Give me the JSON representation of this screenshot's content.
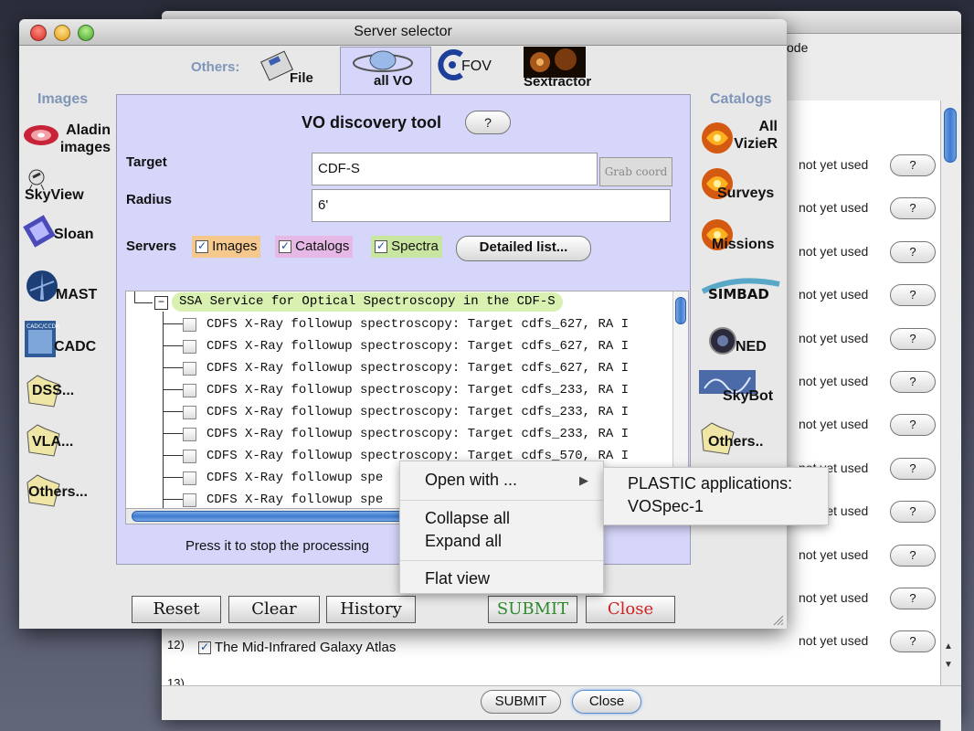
{
  "background_window": {
    "partial_title": "ode",
    "row_status": "not yet used",
    "row_help": "?",
    "rows_count_visible": 12,
    "row12_index": "12)",
    "row12_label": "The Mid-Infrared Galaxy Atlas",
    "row13_index": "13)",
    "submit_label": "SUBMIT",
    "close_label": "Close",
    "scroll_up": "▲",
    "scroll_down": "▼"
  },
  "window": {
    "title": "Server selector"
  },
  "left_sidebar": {
    "header": "Images",
    "items": [
      "Aladin images",
      "SkyView",
      "Sloan",
      "MAST",
      "CADC",
      "DSS...",
      "VLA...",
      "Others..."
    ]
  },
  "right_sidebar": {
    "header": "Catalogs",
    "items": [
      "All VizieR",
      "Surveys",
      "Missions",
      "SIMBAD",
      "NED",
      "SkyBot",
      "Others.."
    ]
  },
  "tabs": {
    "others_label": "Others:",
    "items": [
      "File",
      "all VO",
      "FOV",
      "Sextractor"
    ]
  },
  "panel": {
    "title": "VO discovery tool",
    "help": "?",
    "target_label": "Target",
    "target_value": "CDF-S",
    "grab_label": "Grab coord",
    "radius_label": "Radius",
    "radius_value": "6'",
    "servers_label": "Servers",
    "server_checks": [
      "Images",
      "Catalogs",
      "Spectra"
    ],
    "detailed_label": "Detailed list...",
    "status": "Press it to stop the processing"
  },
  "tree": {
    "collapse_symbol": "−",
    "root": "SSA Service for Optical Spectroscopy in the CDF-S",
    "rows": [
      "CDFS X-Ray followup spectroscopy: Target cdfs_627, RA I",
      "CDFS X-Ray followup spectroscopy: Target cdfs_627, RA I",
      "CDFS X-Ray followup spectroscopy: Target cdfs_627, RA I",
      "CDFS X-Ray followup spectroscopy: Target cdfs_233, RA I",
      "CDFS X-Ray followup spectroscopy: Target cdfs_233, RA I",
      "CDFS X-Ray followup spectroscopy: Target cdfs_233, RA I",
      "CDFS X-Ray followup spectroscopy: Target cdfs_570, RA I",
      "CDFS X-Ray followup spe",
      "CDFS X-Ray followup spe"
    ]
  },
  "buttons": {
    "reset": "Reset",
    "clear": "Clear",
    "history": "History",
    "submit": "SUBMIT",
    "close": "Close"
  },
  "context_menu": {
    "open_with": "Open with ...",
    "collapse_all": "Collapse all",
    "expand_all": "Expand all",
    "flat_view": "Flat view"
  },
  "submenu": {
    "header": "PLASTIC applications:",
    "app": "VOSpec-1"
  },
  "colors": {
    "panel_bg": "#d6d6fa",
    "images_chk": "#f5c98e",
    "catalogs_chk": "#e5b8e5",
    "spectra_chk": "#c8e6a0",
    "submit_text": "#2e8b2e",
    "close_text": "#cc2222",
    "tree_root_highlight": "#d8f0b0"
  }
}
